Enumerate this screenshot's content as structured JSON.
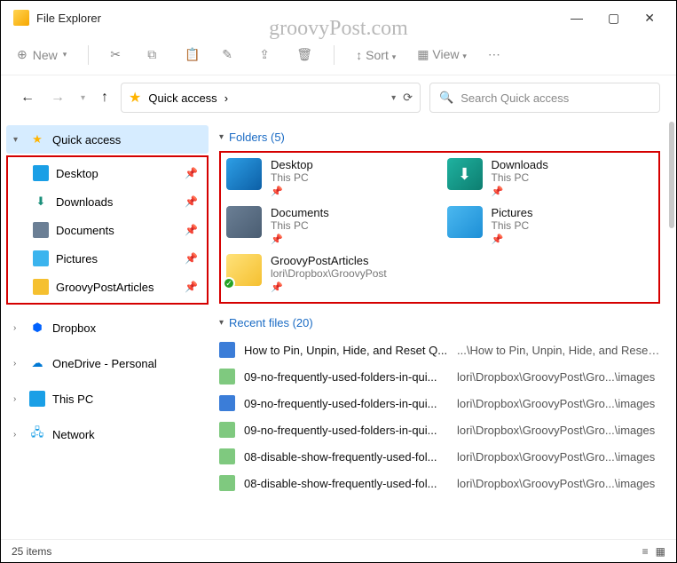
{
  "window": {
    "title": "File Explorer",
    "watermark": "groovyPost.com"
  },
  "toolbar": {
    "new": "New",
    "sort": "Sort",
    "view": "View"
  },
  "address": {
    "location": "Quick access",
    "chevron": "›"
  },
  "search": {
    "placeholder": "Search Quick access"
  },
  "sidebar": {
    "quick": "Quick access",
    "items": [
      {
        "label": "Desktop"
      },
      {
        "label": "Downloads"
      },
      {
        "label": "Documents"
      },
      {
        "label": "Pictures"
      },
      {
        "label": "GroovyPostArticles"
      }
    ],
    "roots": [
      {
        "label": "Dropbox"
      },
      {
        "label": "OneDrive - Personal"
      },
      {
        "label": "This PC"
      },
      {
        "label": "Network"
      }
    ]
  },
  "folders": {
    "header": "Folders (5)",
    "items": [
      {
        "name": "Desktop",
        "sub": "This PC"
      },
      {
        "name": "Downloads",
        "sub": "This PC"
      },
      {
        "name": "Documents",
        "sub": "This PC"
      },
      {
        "name": "Pictures",
        "sub": "This PC"
      },
      {
        "name": "GroovyPostArticles",
        "sub": "lori\\Dropbox\\GroovyPost"
      }
    ]
  },
  "recent": {
    "header": "Recent files (20)",
    "items": [
      {
        "name": "How to Pin, Unpin, Hide, and Reset Q...",
        "path": "...\\How to Pin, Unpin, Hide, and Reset ..."
      },
      {
        "name": "09-no-frequently-used-folders-in-qui...",
        "path": "lori\\Dropbox\\GroovyPost\\Gro...\\images"
      },
      {
        "name": "09-no-frequently-used-folders-in-qui...",
        "path": "lori\\Dropbox\\GroovyPost\\Gro...\\images"
      },
      {
        "name": "09-no-frequently-used-folders-in-qui...",
        "path": "lori\\Dropbox\\GroovyPost\\Gro...\\images"
      },
      {
        "name": "08-disable-show-frequently-used-fol...",
        "path": "lori\\Dropbox\\GroovyPost\\Gro...\\images"
      },
      {
        "name": "08-disable-show-frequently-used-fol...",
        "path": "lori\\Dropbox\\GroovyPost\\Gro...\\images"
      }
    ]
  },
  "status": {
    "text": "25 items"
  }
}
